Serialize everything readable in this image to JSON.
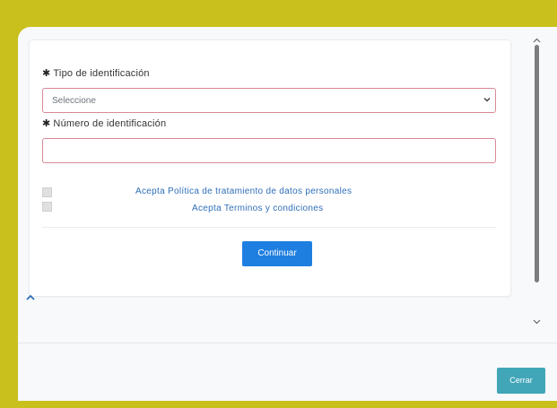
{
  "form": {
    "tipo_label": "Tipo de identificación",
    "tipo_required": "✱",
    "tipo_selected": "Seleccione",
    "numero_label": "Número de identificación",
    "numero_required": "✱",
    "numero_value": "",
    "consent_privacy": "Acepta Política de tratamiento de datos personales",
    "consent_terms": "Acepta Terminos y condiciones",
    "continue_label": "Continuar"
  },
  "footer": {
    "close_label": "Cerrar"
  },
  "icons": {
    "select": "chevron-down-icon",
    "collapse": "caret-up-icon"
  },
  "colors": {
    "frame": "#c9c01e",
    "primary": "#1f7fe0",
    "close": "#40a6b8",
    "invalid_border": "#d98896",
    "link": "#2f6fb8"
  }
}
